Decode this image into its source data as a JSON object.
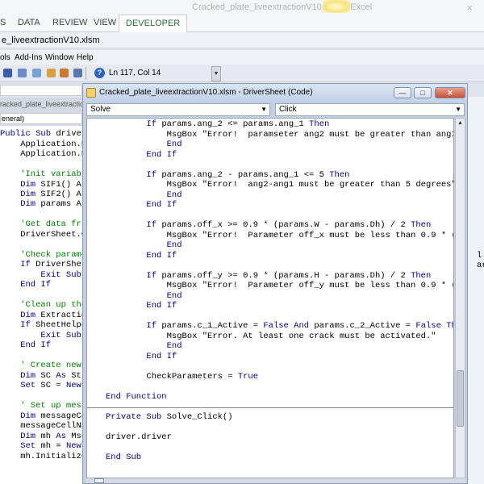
{
  "excel": {
    "title": "Cracked_plate_liveextractionV10.xlsm - Excel",
    "tabs": [
      "S",
      "DATA",
      "REVIEW",
      "VIEW",
      "DEVELOPER"
    ],
    "close_label": "×"
  },
  "vbe": {
    "title": "e_liveextractionV10.xlsm",
    "menu": [
      "ols",
      "Add-Ins",
      "Window",
      "Help"
    ],
    "position": "Ln 117, Col 14",
    "proc_box": "eneral)",
    "bg_window_title": "racked_plate_liveextractionV10.xlsm",
    "right_fragment": "l ar"
  },
  "code_window": {
    "title": "Cracked_plate_liveextractionV10.xlsm - DriverSheet (Code)",
    "object_combo": "Solve",
    "proc_combo": "Click",
    "btn_min": "—",
    "btn_max": "□",
    "btn_close": "✕"
  },
  "colors": {
    "keyword": "#00008b",
    "comment": "#008000",
    "text": "#000000"
  }
}
